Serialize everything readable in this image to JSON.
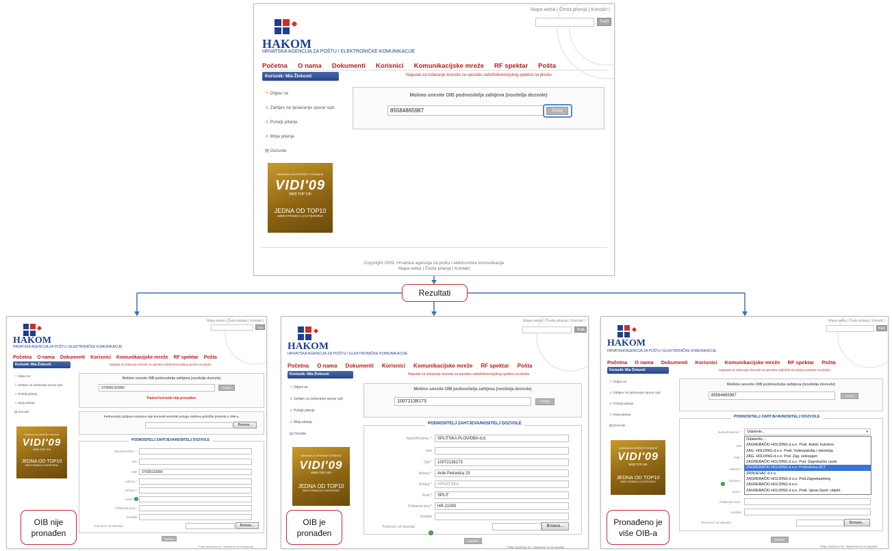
{
  "site": {
    "brand": "HAKOM",
    "agency": "HRVATSKA AGENCIJA ZA POŠTU I ELEKTRONIČKE KOMUNIKACIJE",
    "top_links": "Mapa weba | Česta pitanja | Kontakt |",
    "search_button": "Traži",
    "nav": [
      "Početna",
      "O nama",
      "Dokumenti",
      "Korisnici",
      "Komunikacijske mreže",
      "RF spektar",
      "Pošta"
    ],
    "user_bar": "Korisnik: Mia Živković",
    "notice": "Naputak za izdavanje dozvole za uporabu radiofrekvencijskog spektra na plovilu",
    "sidebar": [
      "Odjavi se",
      "Zahtjev za rješavanje spora/ upit",
      "Pošalji pitanje",
      "Moja pitanja",
      "Dozvole"
    ],
    "banner": {
      "top": "NAGRADA ZA INTERNET STRANICE",
      "big": "VIDI'09",
      "sub": "WEB TOP 100",
      "line1": "JEDNA OD TOP10",
      "line2": "WEB STRANICA U KATEGORIJI"
    },
    "oib_prompt": "Molimo unesite OIB podnositelja zahtjeva (nositelja dozvole)",
    "find_button": "Dodaj",
    "copyright": "Copyright 2009, Hrvatska agencija za poštu i elektroničke komunikacije",
    "footer_links": "Mapa weba | Česta pitanja | Kontakt"
  },
  "main": {
    "oib_value": "85584865987"
  },
  "results_label": "Rezultati",
  "panel1": {
    "oib_value": "37008132589",
    "error": "Traženi korisnik nije pronađen.",
    "info": "Podnositelj zahtjeva trenutno nije korisnik HAKOM usluga. Molimo priložite potvrdu o OIB-u.",
    "browse": "Browse...",
    "legend": "PODNOSITELJ ZAHTJEVA/NOSITELJ DOZVOLE",
    "labels": [
      "Naziv/Prezime: *",
      "Ime",
      "OIB",
      "Adresa *",
      "Država *",
      "Grad *",
      "Poštanski broj *",
      "Kontakt",
      "Punomoć od vlasnika"
    ],
    "oib_field": "37008132589",
    "submit": "Spremi",
    "footnote": "Polja označena sa * obavezna su za popuniti",
    "callout": [
      "OIB nije",
      "pronađen"
    ]
  },
  "panel2": {
    "oib_value": "10072138173",
    "legend": "PODNOSITELJ ZAHTJEVA/NOSITELJ DOZVOLE",
    "labels": [
      "Naziv/Prezime: *",
      "Ime",
      "OIB *",
      "Adresa *",
      "Država *",
      "Grad *",
      "Poštanski broj *",
      "Kontakt",
      "Punomoć od vlasnika"
    ],
    "values": [
      "SPLITSKA PLOVIDBA d.d.",
      "",
      "10072138173",
      "Ante Petravića 23",
      "HRVATSKA",
      "SPLIT",
      "HR-21000",
      ""
    ],
    "browse": "Browse...",
    "submit": "Spremi",
    "footnote": "Polja označena sa * obavezna su za popuniti",
    "callout": [
      "OIB je",
      "pronađen"
    ]
  },
  "panel3": {
    "oib_value": "85584865987",
    "legend": "PODNOSITELJ ZAHTJEVA/NOSITELJ DOZVOLE",
    "labels": [
      "Naziv/Prezime: *",
      "Ime",
      "OIB *",
      "Adresa *",
      "Država *",
      "Grad *",
      "Poštanski broj *",
      "Kontakt",
      "Punomoć od vlasnika"
    ],
    "select_value": "Odaberite...",
    "options": [
      "Odaberite...",
      "ZAGREBAČKI HOLDING d.o.o. Podr. Autob. kolodvor",
      "ZAG. HOLDING d.o.o. Podr. Vodoopskrba i odvodnja",
      "ZAG. HOLDING d.o.o. Pod. Zag. velesajam",
      "ZAGREBAČKI HOLDING d.o.o. Pod. Zagrebačke ceste",
      "ZAGREBAČKI HOLDING d.o.o. Podružnica ZET",
      "ZRINJEVAC d.o.o.",
      "ZAGREBAČKI HOLDING d.o.o. Pod.Zagrebparking",
      "ZAGREBAČKI HOLDING d.o.o.",
      "ZAGREBAČKI HOLDING d.o.o. Podr. Uprav.Sport. objekt."
    ],
    "selected_index": 5,
    "browse": "Browse...",
    "submit": "Spremi",
    "footnote": "Polja označena sa * obavezna su za popuniti",
    "callout": [
      "Pronađeno je",
      "više OIB-a"
    ]
  },
  "colors": {
    "connector": "#3a6fc4",
    "callout_border": "#c8262b",
    "nav_red": "#b81b1b",
    "brand_blue": "#1d3f8f"
  }
}
